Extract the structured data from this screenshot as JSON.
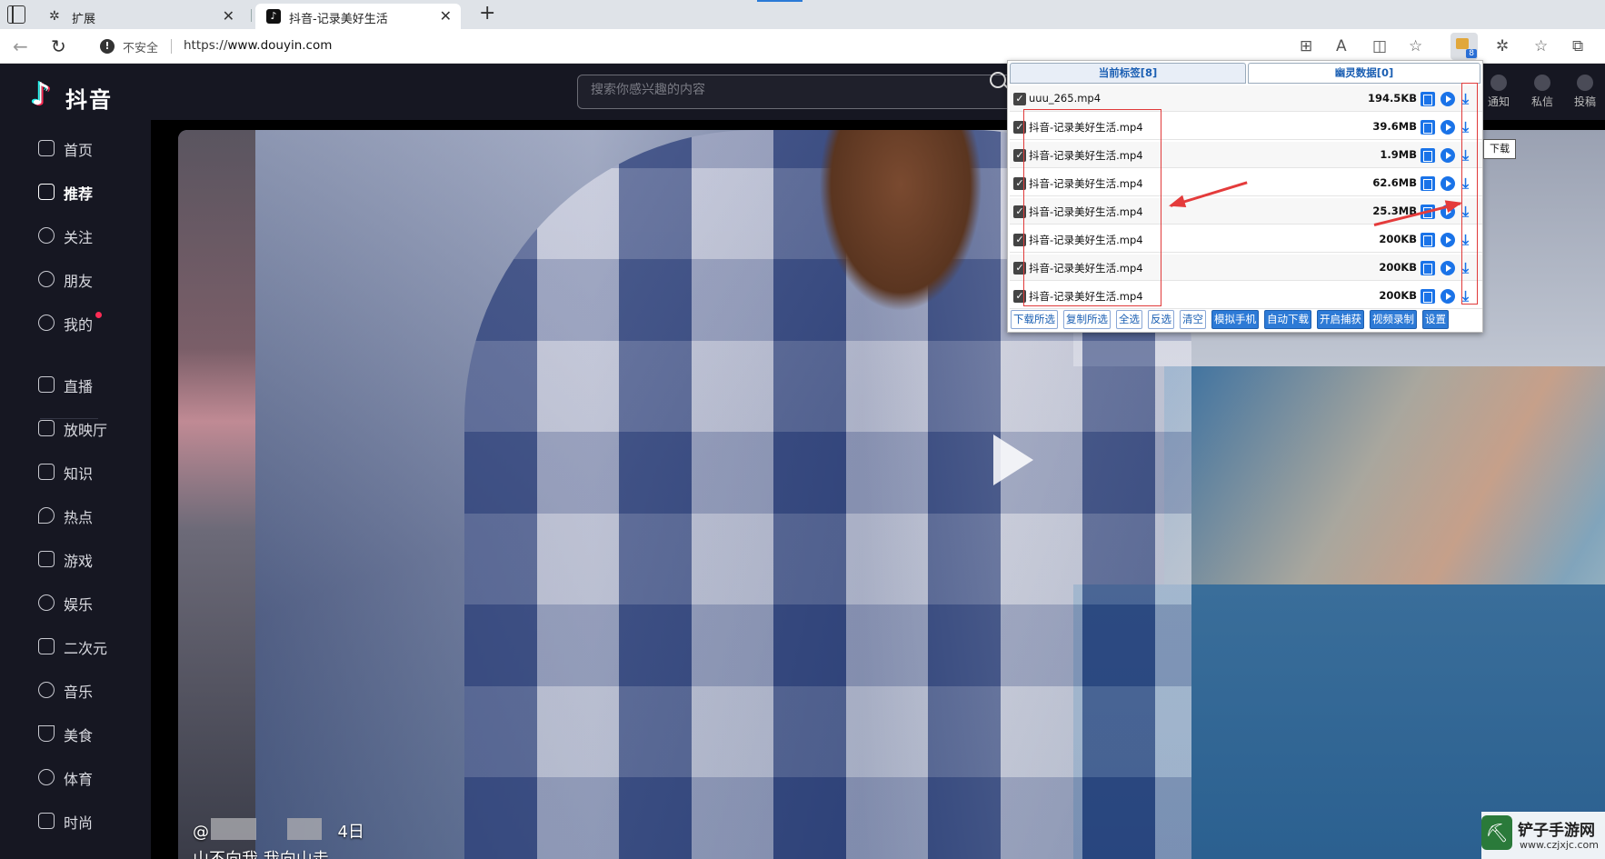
{
  "browser": {
    "tabs": [
      {
        "label": "扩展",
        "active": false
      },
      {
        "label": "抖音-记录美好生活",
        "active": true
      }
    ],
    "new_tab": "+",
    "address": {
      "security_label": "不安全",
      "scheme": "https://",
      "domain": "www.douyin.com"
    },
    "extension_badge": "8"
  },
  "douyin": {
    "logo_text": "抖音",
    "sidebar": [
      {
        "label": "首页",
        "icon": "home-icon"
      },
      {
        "label": "推荐",
        "icon": "thumb-up-icon",
        "active": true
      },
      {
        "label": "关注",
        "icon": "follow-icon"
      },
      {
        "label": "朋友",
        "icon": "friends-icon"
      },
      {
        "label": "我的",
        "icon": "user-icon",
        "dot": true
      },
      {
        "label": "直播",
        "icon": "live-icon"
      },
      {
        "label": "放映厅",
        "icon": "tv-icon"
      },
      {
        "label": "知识",
        "icon": "bookmark-icon"
      },
      {
        "label": "热点",
        "icon": "fire-icon"
      },
      {
        "label": "游戏",
        "icon": "gamepad-icon"
      },
      {
        "label": "娱乐",
        "icon": "smile-icon"
      },
      {
        "label": "二次元",
        "icon": "anime-icon"
      },
      {
        "label": "音乐",
        "icon": "music-icon"
      },
      {
        "label": "美食",
        "icon": "food-icon"
      },
      {
        "label": "体育",
        "icon": "sports-icon"
      },
      {
        "label": "时尚",
        "icon": "fashion-icon"
      }
    ],
    "search_placeholder": "搜索你感兴趣的内容",
    "top_right": [
      {
        "label": "通知"
      },
      {
        "label": "私信"
      },
      {
        "label": "投稿"
      }
    ],
    "video": {
      "author_prefix": "@",
      "date": "4日",
      "caption": "山不向我 我向山走"
    }
  },
  "extension_popup": {
    "tabs": [
      "当前标签[8]",
      "幽灵数据[0]"
    ],
    "files": [
      {
        "name": "uuu_265.mp4",
        "size": "194.5KB"
      },
      {
        "name": "抖音-记录美好生活.mp4",
        "size": "39.6MB"
      },
      {
        "name": "抖音-记录美好生活.mp4",
        "size": "1.9MB"
      },
      {
        "name": "抖音-记录美好生活.mp4",
        "size": "62.6MB"
      },
      {
        "name": "抖音-记录美好生活.mp4",
        "size": "25.3MB"
      },
      {
        "name": "抖音-记录美好生活.mp4",
        "size": "200KB"
      },
      {
        "name": "抖音-记录美好生活.mp4",
        "size": "200KB"
      },
      {
        "name": "抖音-记录美好生活.mp4",
        "size": "200KB"
      }
    ],
    "buttons": [
      {
        "label": "下载所选",
        "style": "light"
      },
      {
        "label": "复制所选",
        "style": "light"
      },
      {
        "label": "全选",
        "style": "light"
      },
      {
        "label": "反选",
        "style": "light"
      },
      {
        "label": "清空",
        "style": "light"
      },
      {
        "label": "模拟手机",
        "style": "blue"
      },
      {
        "label": "自动下载",
        "style": "blue"
      },
      {
        "label": "开启捕获",
        "style": "blue"
      },
      {
        "label": "视频录制",
        "style": "blue"
      },
      {
        "label": "设置",
        "style": "blue"
      }
    ],
    "tooltip": "下载"
  },
  "watermark": {
    "title": "铲子手游网",
    "url": "www.czjxjc.com"
  },
  "colors": {
    "douyin_bg": "#161722",
    "accent_blue": "#1a73e8",
    "annotation_red": "#e03a3a",
    "badge_red": "#fe2c55"
  }
}
